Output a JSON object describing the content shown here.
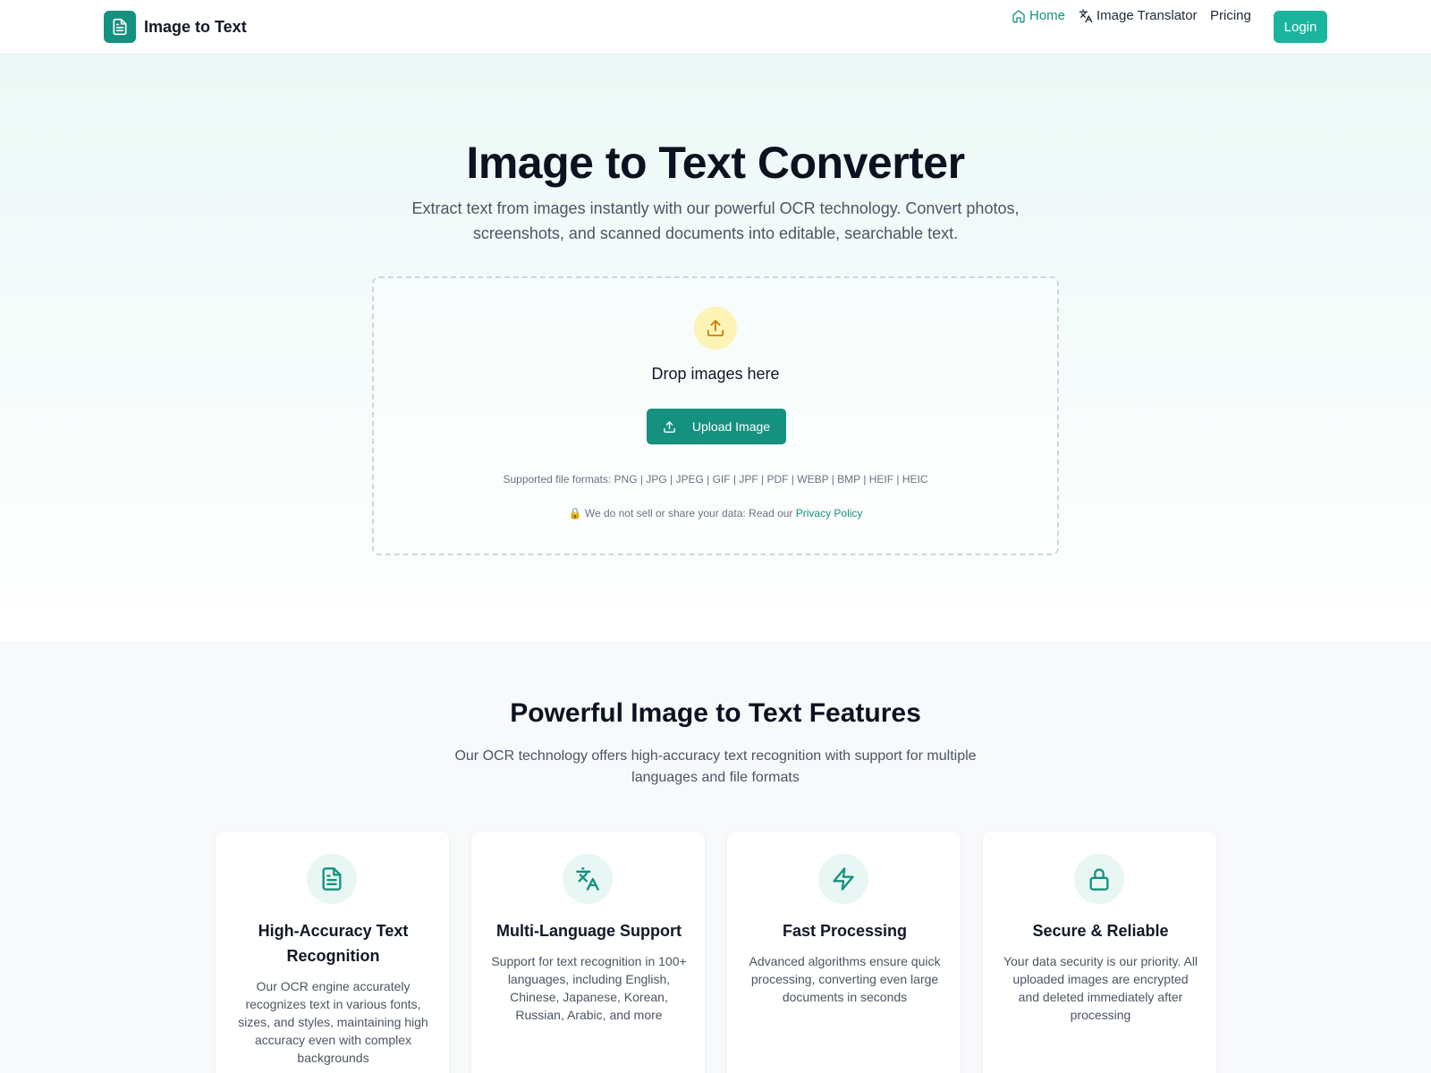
{
  "header": {
    "brand_name": "Image to Text",
    "nav": {
      "home": "Home",
      "image_translator": "Image Translator",
      "pricing": "Pricing"
    },
    "login": "Login"
  },
  "hero": {
    "title": "Image to Text Converter",
    "subtitle": "Extract text from images instantly with our powerful OCR technology. Convert photos, screenshots, and scanned documents into editable, searchable text.",
    "drop_text": "Drop images here",
    "upload_button": "Upload Image",
    "formats": "Supported file formats: PNG | JPG | JPEG | GIF | JPF | PDF | WEBP | BMP | HEIF | HEIC",
    "privacy_text": "🔒 We do not sell or share your data: Read our ",
    "privacy_link": "Privacy Policy"
  },
  "features": {
    "title": "Powerful Image to Text Features",
    "subtitle": "Our OCR technology offers high-accuracy text recognition with support for multiple languages and file formats",
    "cards": [
      {
        "icon": "document-icon",
        "title": "High-Accuracy Text Recognition",
        "description": "Our OCR engine accurately recognizes text in various fonts, sizes, and styles, maintaining high accuracy even with complex backgrounds"
      },
      {
        "icon": "translate-icon",
        "title": "Multi-Language Support",
        "description": "Support for text recognition in 100+ languages, including English, Chinese, Japanese, Korean, Russian, Arabic, and more"
      },
      {
        "icon": "lightning-icon",
        "title": "Fast Processing",
        "description": "Advanced algorithms ensure quick processing, converting even large documents in seconds"
      },
      {
        "icon": "lock-icon",
        "title": "Secure & Reliable",
        "description": "Your data security is our priority. All uploaded images are encrypted and deleted immediately after processing"
      }
    ]
  },
  "colors": {
    "primary": "#14917f",
    "login": "#19b59d",
    "upload_circle": "#fdf3b4"
  }
}
